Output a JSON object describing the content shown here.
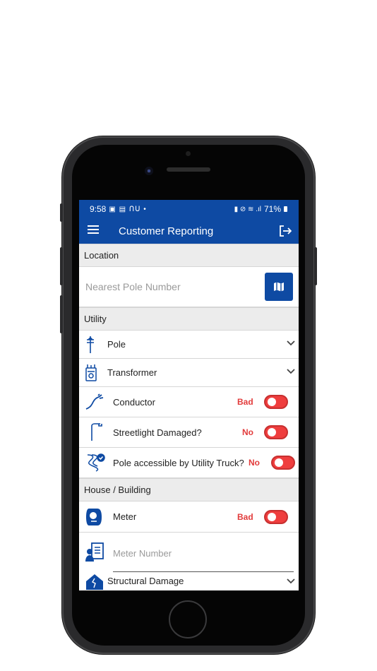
{
  "status_bar": {
    "time": "9:58",
    "battery": "71%"
  },
  "app_bar": {
    "title": "Customer Reporting"
  },
  "sections": {
    "location": "Location",
    "utility": "Utility",
    "house": "House / Building"
  },
  "location": {
    "pole_placeholder": "Nearest Pole Number"
  },
  "utility": {
    "pole_label": "Pole",
    "transformer_label": "Transformer",
    "conductor": {
      "label": "Conductor",
      "status": "Bad"
    },
    "streetlight": {
      "label": "Streetlight Damaged?",
      "status": "No"
    },
    "accessible": {
      "label": "Pole accessible by Utility Truck?",
      "status": "No"
    }
  },
  "house": {
    "meter": {
      "label": "Meter",
      "status": "Bad"
    },
    "meter_number_placeholder": "Meter Number",
    "structural_label": "Structural Damage"
  },
  "colors": {
    "primary": "#0e4aa3",
    "alert": "#e23b3b",
    "section_bg": "#ececec"
  },
  "icons": [
    "menu-icon",
    "logout-icon",
    "map-icon",
    "pole-icon",
    "transformer-icon",
    "conductor-icon",
    "streetlight-icon",
    "truck-road-icon",
    "meter-icon",
    "meter-number-icon",
    "house-damage-icon",
    "chevron-down-icon"
  ]
}
